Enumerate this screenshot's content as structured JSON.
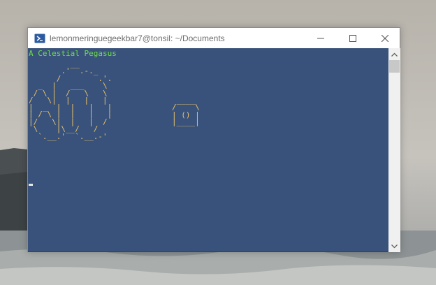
{
  "window": {
    "title": "lemonmeringuegeekbar7@tonsil: ~/Documents",
    "icon": "powershell-icon"
  },
  "console": {
    "heading": "A Celestial Pegasus",
    "art_a": "         __\n       .'  .-._\n      /        .'.\n  _  |   ___    \\\n / \\ |  /   \\   \\\n/   \\|  |   |   |",
    "art_b": "|  _  |  |   |   |\n| / \\ |  |   |   |\n|/   \\|  |   |  /\n \\    |\\__/   /\n  `.__.'  `.__.-'",
    "moon": " ____\n/    \\\n| () |\n|____|"
  },
  "colors": {
    "console_bg": "#183565",
    "heading": "#6ede4b",
    "art": "#e8c36a"
  }
}
